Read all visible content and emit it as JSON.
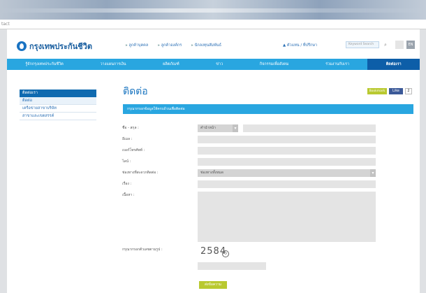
{
  "browser": {
    "url_fragment": "tact"
  },
  "header": {
    "logo_text": "กรุงเทพประกันชีวิต",
    "top_links": [
      "ลูกค้าบุคคล",
      "ลูกค้าองค์กร",
      "นักลงทุนสัมพันธ์"
    ],
    "login_text": "ตัวแทน / ที่ปรึกษา",
    "search_placeholder": "Keyword Search",
    "lang_label": "EN"
  },
  "nav": {
    "items": [
      "รู้จักกรุงเทพประกันชีวิต",
      "วางแผนการเงิน",
      "ผลิตภัณฑ์",
      "ข่าว",
      "กิจกรรมเพื่อสังคม",
      "ร่วมงานกับเรา",
      "ติดต่อเรา"
    ],
    "active_index": 6
  },
  "sidebar": {
    "header": "ติดต่อเรา",
    "items": [
      "ติดต่อ",
      "เครือข่ายสาขาบริษัท",
      "สาขาและเขตสรรค์"
    ]
  },
  "main": {
    "title": "ติดต่อ",
    "social": {
      "share_label": "Bookmark",
      "fb_label": "Like",
      "count": "2"
    },
    "form_banner": "กรุณากรอกข้อมูลให้ครบถ้วนเพื่อติดต่อ",
    "form": {
      "name_label": "ชื่อ - สกุล :",
      "title_select": "คำนำหน้า",
      "email_label": "อีเมล :",
      "phone_label": "เบอร์โทรศัพท์ :",
      "line_label": "ไลน์ :",
      "channel_label": "ช่องทางที่สะดวกติดต่อ :",
      "channel_select": "ช่องทางทั้งหมด",
      "subject_label": "เรื่อง :",
      "detail_label": "เนื้อหา :",
      "captcha_label": "กรุณากรอกตัวเลขตามรูป :",
      "captcha_value": "2584",
      "submit_label": "ส่งข้อความ"
    }
  },
  "colors": {
    "primary": "#29a6e0",
    "dark": "#0d5ea8",
    "accent": "#b9c930"
  }
}
